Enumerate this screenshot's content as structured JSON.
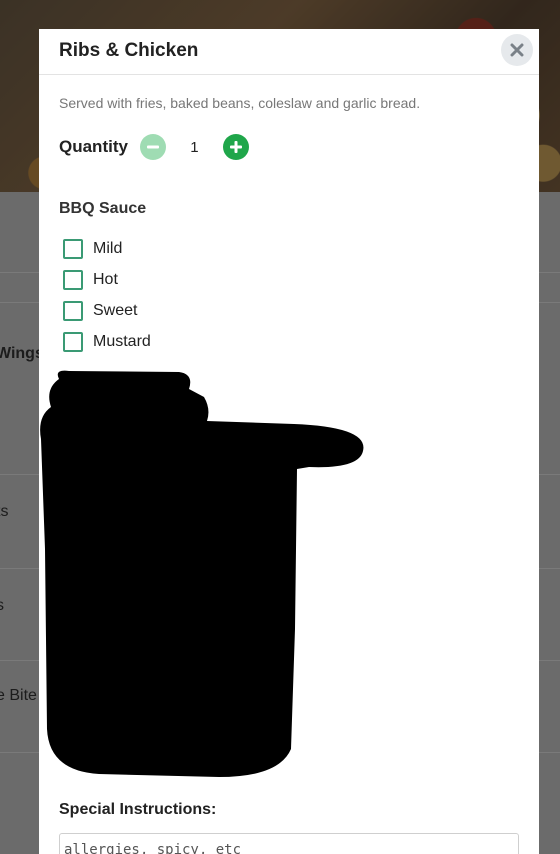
{
  "background": {
    "rows": [
      {
        "label": "Wings"
      },
      {
        "label": "ts"
      },
      {
        "label": "s"
      },
      {
        "label": "e Bite"
      }
    ]
  },
  "modal": {
    "title": "Ribs & Chicken",
    "description": "Served with fries, baked beans, coleslaw and garlic bread.",
    "quantity": {
      "label": "Quantity",
      "value": "1"
    },
    "bbq_sauce": {
      "title": "BBQ Sauce",
      "options": [
        {
          "label": "Mild",
          "checked": false
        },
        {
          "label": "Hot",
          "checked": false
        },
        {
          "label": "Sweet",
          "checked": false
        },
        {
          "label": "Mustard",
          "checked": false
        }
      ]
    },
    "special_instructions": {
      "label": "Special Instructions:",
      "placeholder": "allergies, spicy, etc"
    }
  },
  "colors": {
    "accent_green": "#1fa64a",
    "checkbox_border": "#3a9a74"
  },
  "icons": {
    "close": "close-icon",
    "minus": "minus-icon",
    "plus": "plus-icon"
  }
}
